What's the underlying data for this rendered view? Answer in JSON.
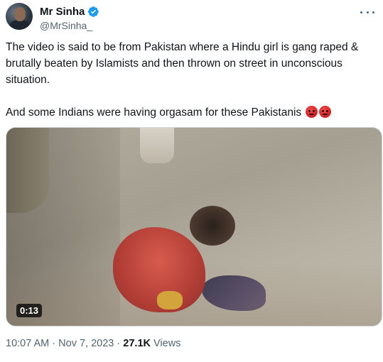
{
  "author": {
    "display_name": "Mr Sinha",
    "handle": "@MrSinha_",
    "verified_icon": "verified-badge-icon",
    "verified_color": "#1d9bf0"
  },
  "menu_icon": "more-horizontal-icon",
  "tweet": {
    "paragraph_1": "The video is said to be from Pakistan where a Hindu girl is gang raped & brutally beaten by Islamists and then thrown on street in unconscious situation.",
    "paragraph_2": "And some Indians were having orgasam for these Pakistanis",
    "emojis": [
      "angry-face-icon",
      "angry-face-icon"
    ]
  },
  "media": {
    "type": "video",
    "duration": "0:13"
  },
  "meta": {
    "time": "10:07 AM",
    "separator_1": "·",
    "date": "Nov 7, 2023",
    "separator_2": "·",
    "views_count": "27.1K",
    "views_label": "Views"
  },
  "colors": {
    "text_primary": "#0f1419",
    "text_secondary": "#536471",
    "border": "#cfd9de"
  }
}
